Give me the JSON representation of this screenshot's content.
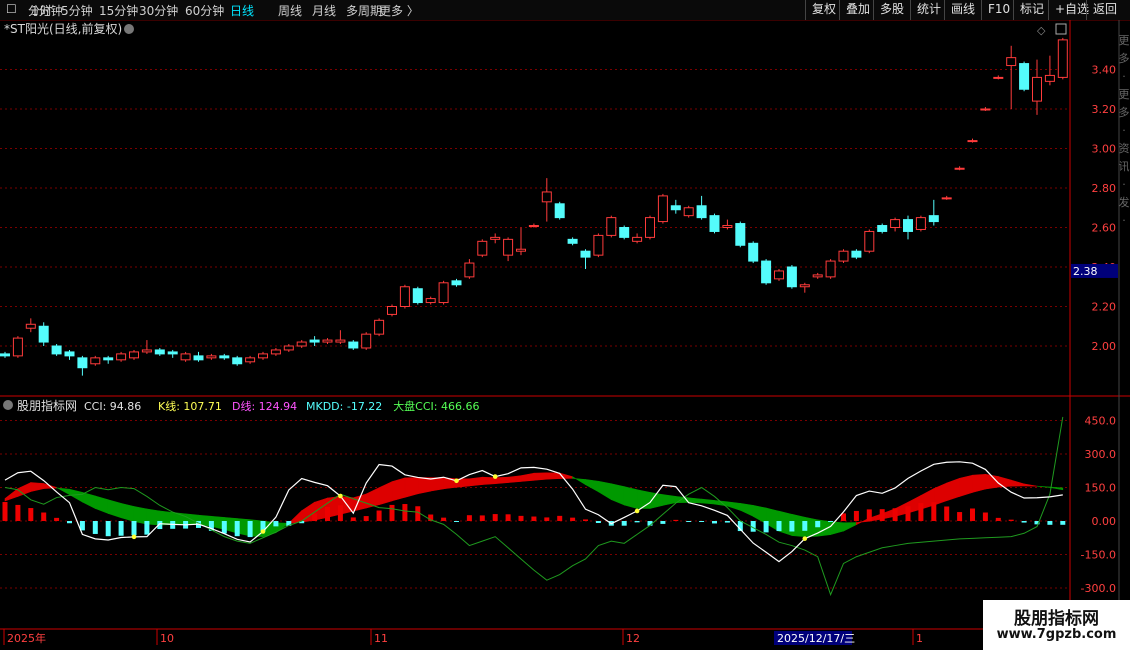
{
  "toolbar": {
    "left": [
      "分时",
      "1分钟",
      "5分钟",
      "15分钟",
      "30分钟",
      "60分钟",
      "日线",
      "周线",
      "月线",
      "多周期",
      "更多 〉"
    ],
    "active": "日线",
    "right": [
      "复权",
      "叠加",
      "多股",
      "统计",
      "画线",
      "F10",
      "标记",
      "+自选",
      "返回"
    ]
  },
  "price_panel": {
    "title": "*ST阳光(日线,前复权)",
    "current_price_tag": "2.38",
    "yticks": [
      "3.40",
      "3.20",
      "3.00",
      "2.80",
      "2.60",
      "2.40",
      "2.20",
      "2.00"
    ],
    "side_text": "更多·更多·资讯·发·"
  },
  "indicator_panel": {
    "name": "股朋指标网",
    "readouts": [
      {
        "label": "CCI: 94.86",
        "color": "#e0e0e0"
      },
      {
        "label": "K线: 107.71",
        "color": "#ffff55"
      },
      {
        "label": "D线: 124.94",
        "color": "#ff55ff"
      },
      {
        "label": "MKDD: -17.22",
        "color": "#55ffff"
      },
      {
        "label": "大盘CCI: 466.66",
        "color": "#55ff55"
      }
    ],
    "yticks": [
      "450.0",
      "300.0",
      "150.0",
      "0.00",
      "-150.0",
      "-300.0"
    ]
  },
  "date_axis": {
    "labels": [
      "2025年",
      "10",
      "11",
      "12",
      "1"
    ],
    "crosshair_date": "2025/12/17/三"
  },
  "watermark": {
    "line1": "股朋指标网",
    "line2": "www.7gpzb.com"
  },
  "colors": {
    "up": "#ff3b3b",
    "down": "#54fcfc",
    "grid": "#7a0000",
    "axis": "#cc0000",
    "label": "#ff4040"
  },
  "chart_data": [
    {
      "type": "candlestick",
      "title": "*ST阳光(日线,前复权)",
      "ylim": [
        1.78,
        3.6
      ],
      "candles": [
        {
          "o": 1.96,
          "c": 1.95,
          "h": 1.97,
          "l": 1.94
        },
        {
          "o": 1.95,
          "c": 2.04,
          "h": 2.05,
          "l": 1.94
        },
        {
          "o": 2.09,
          "c": 2.11,
          "h": 2.14,
          "l": 2.07
        },
        {
          "o": 2.1,
          "c": 2.02,
          "h": 2.12,
          "l": 2.0
        },
        {
          "o": 2.0,
          "c": 1.96,
          "h": 2.01,
          "l": 1.95
        },
        {
          "o": 1.97,
          "c": 1.95,
          "h": 1.98,
          "l": 1.93
        },
        {
          "o": 1.94,
          "c": 1.89,
          "h": 1.95,
          "l": 1.85
        },
        {
          "o": 1.91,
          "c": 1.94,
          "h": 1.95,
          "l": 1.9
        },
        {
          "o": 1.94,
          "c": 1.93,
          "h": 1.95,
          "l": 1.91
        },
        {
          "o": 1.93,
          "c": 1.96,
          "h": 1.97,
          "l": 1.92
        },
        {
          "o": 1.94,
          "c": 1.97,
          "h": 1.98,
          "l": 1.93
        },
        {
          "o": 1.97,
          "c": 1.98,
          "h": 2.03,
          "l": 1.96
        },
        {
          "o": 1.98,
          "c": 1.96,
          "h": 1.99,
          "l": 1.95
        },
        {
          "o": 1.97,
          "c": 1.96,
          "h": 1.98,
          "l": 1.94
        },
        {
          "o": 1.93,
          "c": 1.96,
          "h": 1.97,
          "l": 1.92
        },
        {
          "o": 1.95,
          "c": 1.93,
          "h": 1.97,
          "l": 1.92
        },
        {
          "o": 1.94,
          "c": 1.95,
          "h": 1.96,
          "l": 1.93
        },
        {
          "o": 1.95,
          "c": 1.94,
          "h": 1.96,
          "l": 1.93
        },
        {
          "o": 1.94,
          "c": 1.91,
          "h": 1.95,
          "l": 1.9
        },
        {
          "o": 1.92,
          "c": 1.94,
          "h": 1.95,
          "l": 1.91
        },
        {
          "o": 1.94,
          "c": 1.96,
          "h": 1.97,
          "l": 1.93
        },
        {
          "o": 1.96,
          "c": 1.98,
          "h": 1.99,
          "l": 1.95
        },
        {
          "o": 1.98,
          "c": 2.0,
          "h": 2.01,
          "l": 1.97
        },
        {
          "o": 2.0,
          "c": 2.02,
          "h": 2.03,
          "l": 1.99
        },
        {
          "o": 2.03,
          "c": 2.02,
          "h": 2.05,
          "l": 2.0
        },
        {
          "o": 2.02,
          "c": 2.03,
          "h": 2.04,
          "l": 2.01
        },
        {
          "o": 2.02,
          "c": 2.03,
          "h": 2.08,
          "l": 2.01
        },
        {
          "o": 2.02,
          "c": 1.99,
          "h": 2.03,
          "l": 1.98
        },
        {
          "o": 1.99,
          "c": 2.06,
          "h": 2.07,
          "l": 1.98
        },
        {
          "o": 2.06,
          "c": 2.13,
          "h": 2.14,
          "l": 2.05
        },
        {
          "o": 2.16,
          "c": 2.2,
          "h": 2.21,
          "l": 2.15
        },
        {
          "o": 2.2,
          "c": 2.3,
          "h": 2.31,
          "l": 2.19
        },
        {
          "o": 2.29,
          "c": 2.22,
          "h": 2.3,
          "l": 2.21
        },
        {
          "o": 2.22,
          "c": 2.24,
          "h": 2.25,
          "l": 2.21
        },
        {
          "o": 2.22,
          "c": 2.32,
          "h": 2.33,
          "l": 2.21
        },
        {
          "o": 2.33,
          "c": 2.31,
          "h": 2.34,
          "l": 2.3
        },
        {
          "o": 2.35,
          "c": 2.42,
          "h": 2.44,
          "l": 2.34
        },
        {
          "o": 2.46,
          "c": 2.53,
          "h": 2.54,
          "l": 2.45
        },
        {
          "o": 2.54,
          "c": 2.55,
          "h": 2.57,
          "l": 2.52
        },
        {
          "o": 2.46,
          "c": 2.54,
          "h": 2.55,
          "l": 2.43
        },
        {
          "o": 2.48,
          "c": 2.49,
          "h": 2.6,
          "l": 2.46
        },
        {
          "o": 2.61,
          "c": 2.61,
          "h": 2.62,
          "l": 2.6
        },
        {
          "o": 2.73,
          "c": 2.78,
          "h": 2.85,
          "l": 2.63
        },
        {
          "o": 2.72,
          "c": 2.65,
          "h": 2.73,
          "l": 2.64
        },
        {
          "o": 2.54,
          "c": 2.52,
          "h": 2.55,
          "l": 2.51
        },
        {
          "o": 2.48,
          "c": 2.45,
          "h": 2.49,
          "l": 2.39
        },
        {
          "o": 2.46,
          "c": 2.56,
          "h": 2.57,
          "l": 2.45
        },
        {
          "o": 2.56,
          "c": 2.65,
          "h": 2.66,
          "l": 2.55
        },
        {
          "o": 2.6,
          "c": 2.55,
          "h": 2.61,
          "l": 2.54
        },
        {
          "o": 2.53,
          "c": 2.55,
          "h": 2.57,
          "l": 2.52
        },
        {
          "o": 2.55,
          "c": 2.65,
          "h": 2.66,
          "l": 2.54
        },
        {
          "o": 2.63,
          "c": 2.76,
          "h": 2.77,
          "l": 2.62
        },
        {
          "o": 2.71,
          "c": 2.69,
          "h": 2.74,
          "l": 2.67
        },
        {
          "o": 2.66,
          "c": 2.7,
          "h": 2.71,
          "l": 2.65
        },
        {
          "o": 2.71,
          "c": 2.65,
          "h": 2.76,
          "l": 2.64
        },
        {
          "o": 2.66,
          "c": 2.58,
          "h": 2.67,
          "l": 2.57
        },
        {
          "o": 2.6,
          "c": 2.61,
          "h": 2.64,
          "l": 2.59
        },
        {
          "o": 2.62,
          "c": 2.51,
          "h": 2.63,
          "l": 2.5
        },
        {
          "o": 2.52,
          "c": 2.43,
          "h": 2.53,
          "l": 2.42
        },
        {
          "o": 2.43,
          "c": 2.32,
          "h": 2.44,
          "l": 2.31
        },
        {
          "o": 2.34,
          "c": 2.38,
          "h": 2.39,
          "l": 2.33
        },
        {
          "o": 2.4,
          "c": 2.3,
          "h": 2.41,
          "l": 2.29
        },
        {
          "o": 2.3,
          "c": 2.31,
          "h": 2.32,
          "l": 2.27
        },
        {
          "o": 2.35,
          "c": 2.36,
          "h": 2.37,
          "l": 2.34
        },
        {
          "o": 2.35,
          "c": 2.43,
          "h": 2.44,
          "l": 2.34
        },
        {
          "o": 2.43,
          "c": 2.48,
          "h": 2.49,
          "l": 2.42
        },
        {
          "o": 2.48,
          "c": 2.45,
          "h": 2.49,
          "l": 2.44
        },
        {
          "o": 2.48,
          "c": 2.58,
          "h": 2.59,
          "l": 2.47
        },
        {
          "o": 2.61,
          "c": 2.58,
          "h": 2.62,
          "l": 2.57
        },
        {
          "o": 2.6,
          "c": 2.64,
          "h": 2.65,
          "l": 2.58
        },
        {
          "o": 2.64,
          "c": 2.58,
          "h": 2.66,
          "l": 2.54
        },
        {
          "o": 2.59,
          "c": 2.65,
          "h": 2.66,
          "l": 2.58
        },
        {
          "o": 2.66,
          "c": 2.63,
          "h": 2.74,
          "l": 2.61
        },
        {
          "o": 2.75,
          "c": 2.75,
          "h": 2.76,
          "l": 2.74
        },
        {
          "o": 2.9,
          "c": 2.9,
          "h": 2.91,
          "l": 2.89
        },
        {
          "o": 3.04,
          "c": 3.04,
          "h": 3.05,
          "l": 3.03
        },
        {
          "o": 3.2,
          "c": 3.2,
          "h": 3.21,
          "l": 3.19
        },
        {
          "o": 3.36,
          "c": 3.36,
          "h": 3.37,
          "l": 3.35
        },
        {
          "o": 3.42,
          "c": 3.46,
          "h": 3.52,
          "l": 3.2
        },
        {
          "o": 3.43,
          "c": 3.3,
          "h": 3.44,
          "l": 3.29
        },
        {
          "o": 3.24,
          "c": 3.36,
          "h": 3.45,
          "l": 3.17
        },
        {
          "o": 3.34,
          "c": 3.37,
          "h": 3.47,
          "l": 3.32
        },
        {
          "o": 3.36,
          "c": 3.55,
          "h": 3.56,
          "l": 3.35
        }
      ]
    },
    {
      "type": "line",
      "title": "股朋指标网",
      "ylim": [
        -340,
        500
      ],
      "series": [
        {
          "name": "CCI",
          "values": [
            183,
            216,
            223,
            181,
            130,
            82,
            -60,
            -80,
            -85,
            -74,
            -71,
            -70,
            -12,
            -15,
            -17,
            -14,
            -34,
            -57,
            -82,
            -94,
            -47,
            17,
            139,
            190,
            173,
            158,
            112,
            35,
            170,
            253,
            246,
            207,
            195,
            188,
            196,
            180,
            208,
            226,
            199,
            212,
            238,
            240,
            232,
            213,
            143,
            53,
            28,
            -12,
            16,
            45,
            83,
            160,
            154,
            82,
            68,
            48,
            25,
            -37,
            -99,
            -140,
            -182,
            -137,
            -79,
            -54,
            -24,
            41,
            114,
            134,
            124,
            148,
            191,
            224,
            254,
            263,
            265,
            259,
            231,
            170,
            129,
            103,
            104,
            108,
            117
          ],
          "color": "#ffffff"
        },
        {
          "name": "K线",
          "values": [
            100,
            145,
            172,
            168,
            150,
            118,
            85,
            56,
            34,
            15,
            -2,
            -14,
            -18,
            -16,
            -14,
            -15,
            -24,
            -38,
            -54,
            -67,
            -70,
            -52,
            -10,
            46,
            84,
            103,
            110,
            104,
            121,
            149,
            176,
            193,
            195,
            194,
            194,
            189,
            189,
            196,
            194,
            196,
            203,
            214,
            216,
            215,
            198,
            163,
            131,
            96,
            72,
            56,
            56,
            70,
            82,
            83,
            81,
            76,
            67,
            48,
            21,
            -12,
            -46,
            -65,
            -70,
            -68,
            -61,
            -45,
            -16,
            13,
            33,
            55,
            84,
            114,
            145,
            170,
            191,
            205,
            209,
            199,
            183,
            166,
            156,
            150,
            140
          ],
          "color": "#ffff55"
        },
        {
          "name": "D线",
          "values": [
            90,
            110,
            132,
            145,
            148,
            142,
            128,
            112,
            95,
            79,
            65,
            54,
            45,
            38,
            32,
            26,
            21,
            16,
            11,
            6,
            0,
            -8,
            -10,
            -5,
            4,
            16,
            30,
            44,
            58,
            73,
            90,
            106,
            122,
            134,
            144,
            151,
            157,
            163,
            167,
            172,
            177,
            182,
            187,
            190,
            191,
            186,
            178,
            167,
            154,
            140,
            128,
            118,
            110,
            104,
            98,
            92,
            86,
            79,
            70,
            58,
            44,
            30,
            17,
            5,
            -3,
            -8,
            -7,
            -1,
            9,
            21,
            36,
            53,
            71,
            91,
            110,
            128,
            143,
            152,
            156,
            157,
            156,
            152,
            148
          ],
          "color": "#ff55ff"
        },
        {
          "name": "大盘CCI",
          "values": [
            150,
            140,
            95,
            75,
            105,
            115,
            120,
            150,
            140,
            150,
            145,
            110,
            70,
            40,
            20,
            -10,
            -40,
            -70,
            -90,
            -100,
            -75,
            -50,
            -20,
            0,
            40,
            80,
            120,
            100,
            80,
            60,
            55,
            45,
            40,
            5,
            -15,
            -60,
            -110,
            -90,
            -70,
            -120,
            -170,
            -220,
            -265,
            -240,
            -200,
            -170,
            -110,
            -90,
            -100,
            -60,
            -20,
            30,
            80,
            120,
            150,
            110,
            60,
            0,
            -30,
            -60,
            -95,
            -110,
            -130,
            -160,
            -330,
            -190,
            -160,
            -140,
            -120,
            -110,
            -100,
            -95,
            -90,
            -85,
            -80,
            -78,
            -75,
            -73,
            -70,
            -55,
            -25,
            120,
            466
          ],
          "color": "#55ff55"
        },
        {
          "name": "MKDD",
          "values": [
            85,
            72,
            58,
            38,
            14,
            -10,
            -42,
            -58,
            -68,
            -66,
            -64,
            -61,
            -36,
            -35,
            -34,
            -31,
            -44,
            -56,
            -68,
            -72,
            -47,
            -24,
            -22,
            -10,
            34,
            63,
            70,
            16,
            22,
            47,
            72,
            76,
            66,
            29,
            15,
            -3,
            26,
            25,
            31,
            30,
            23,
            20,
            16,
            23,
            15,
            7,
            -9,
            -21,
            -21,
            -6,
            -21,
            -13,
            5,
            -4,
            -3,
            -11,
            -7,
            -45,
            -48,
            -51,
            -45,
            -47,
            -44,
            -28,
            -3,
            34,
            45,
            52,
            53,
            57,
            66,
            80,
            84,
            65,
            40,
            56,
            38,
            14,
            6,
            -7,
            -15,
            -17,
            -17
          ],
          "color": "#55ffff"
        }
      ]
    }
  ]
}
